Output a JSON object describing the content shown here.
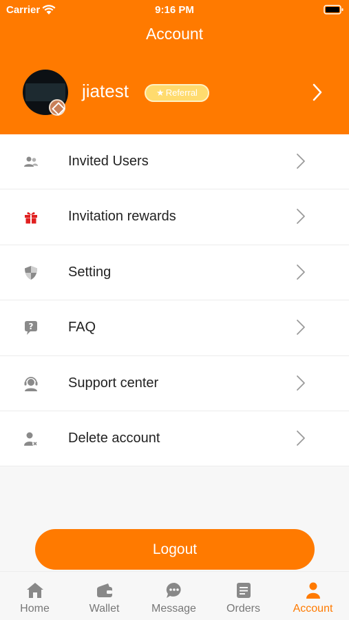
{
  "status_bar": {
    "carrier": "Carrier",
    "time": "9:16 PM"
  },
  "header": {
    "title": "Account"
  },
  "profile": {
    "username": "jiatest",
    "badge": "Referral"
  },
  "menu": [
    {
      "label": "Invited Users",
      "icon": "users-icon"
    },
    {
      "label": "Invitation rewards",
      "icon": "gift-icon"
    },
    {
      "label": "Setting",
      "icon": "shield-icon"
    },
    {
      "label": "FAQ",
      "icon": "help-bubble-icon"
    },
    {
      "label": "Support center",
      "icon": "headset-icon"
    },
    {
      "label": "Delete account",
      "icon": "delete-user-icon"
    }
  ],
  "logout_label": "Logout",
  "tabs": [
    {
      "label": "Home",
      "icon": "home-icon"
    },
    {
      "label": "Wallet",
      "icon": "wallet-icon"
    },
    {
      "label": "Message",
      "icon": "message-icon"
    },
    {
      "label": "Orders",
      "icon": "orders-icon"
    },
    {
      "label": "Account",
      "icon": "account-icon",
      "active": true
    }
  ],
  "colors": {
    "accent": "#FF7A00",
    "badge": "#FFDB6E",
    "gift": "#E02020",
    "icon": "#8a8a8a"
  }
}
